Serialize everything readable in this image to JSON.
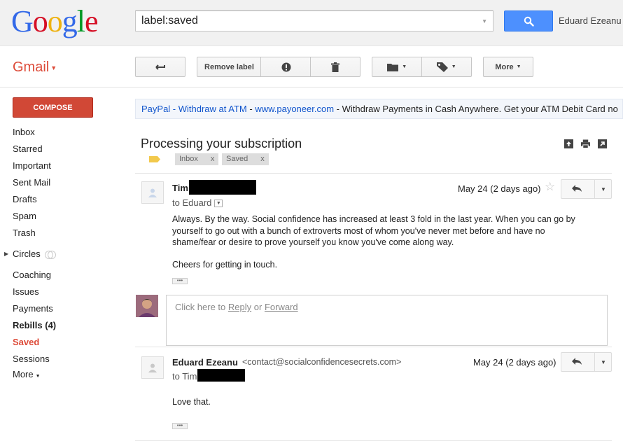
{
  "header": {
    "logo_letters": [
      "G",
      "o",
      "o",
      "g",
      "l",
      "e"
    ],
    "search_query": "label:saved",
    "user_name": "Eduard Ezeanu"
  },
  "toolbar": {
    "app_label": "Gmail",
    "remove_label": "Remove label",
    "more_label": "More"
  },
  "sidebar": {
    "compose_label": "COMPOSE",
    "items": [
      {
        "label": "Inbox"
      },
      {
        "label": "Starred"
      },
      {
        "label": "Important"
      },
      {
        "label": "Sent Mail"
      },
      {
        "label": "Drafts"
      },
      {
        "label": "Spam"
      },
      {
        "label": "Trash"
      },
      {
        "label": "Circles"
      },
      {
        "label": "Coaching"
      },
      {
        "label": "Issues"
      },
      {
        "label": "Payments"
      },
      {
        "label": "Rebills (4)"
      },
      {
        "label": "Saved"
      },
      {
        "label": "Sessions"
      },
      {
        "label": "More"
      }
    ]
  },
  "ad": {
    "title": "PayPal - Withdraw at ATM",
    "sep1": " - ",
    "url": "www.payoneer.com",
    "sep2": " - ",
    "text": "Withdraw Payments in Cash Anywhere. Get your ATM Debit Card no"
  },
  "thread": {
    "subject": "Processing your subscription",
    "labels": [
      {
        "name": "Inbox",
        "remove": "x"
      },
      {
        "name": "Saved",
        "remove": "x"
      }
    ]
  },
  "messages": [
    {
      "sender": "Tim",
      "email": "",
      "to_prefix": "to Eduard",
      "date": "May 24 (2 days ago)",
      "body": [
        "Always. By the way. Social confidence has increased at least 3 fold in the last year. When you can go by",
        "yourself to go out with a bunch of extroverts most of whom you've never met before and have no",
        "shame/fear or desire to prove yourself you know you've come along way.",
        "Cheers for getting in touch."
      ],
      "dots": "•••"
    },
    {
      "sender": "Eduard Ezeanu",
      "email": "<contact@socialconfidencesecrets.com>",
      "to_prefix": "to Tim",
      "date": "May 24 (2 days ago)",
      "body": [
        "Love that."
      ],
      "dots": "•••"
    }
  ],
  "reply": {
    "prefix": "Click here to",
    "reply_link": "Reply",
    "or": "or",
    "forward_link": "Forward"
  },
  "colors": {
    "accent_red": "#dd4b39",
    "compose_red": "#d14836",
    "search_blue": "#4d90fe",
    "link_blue": "#1155cc"
  }
}
